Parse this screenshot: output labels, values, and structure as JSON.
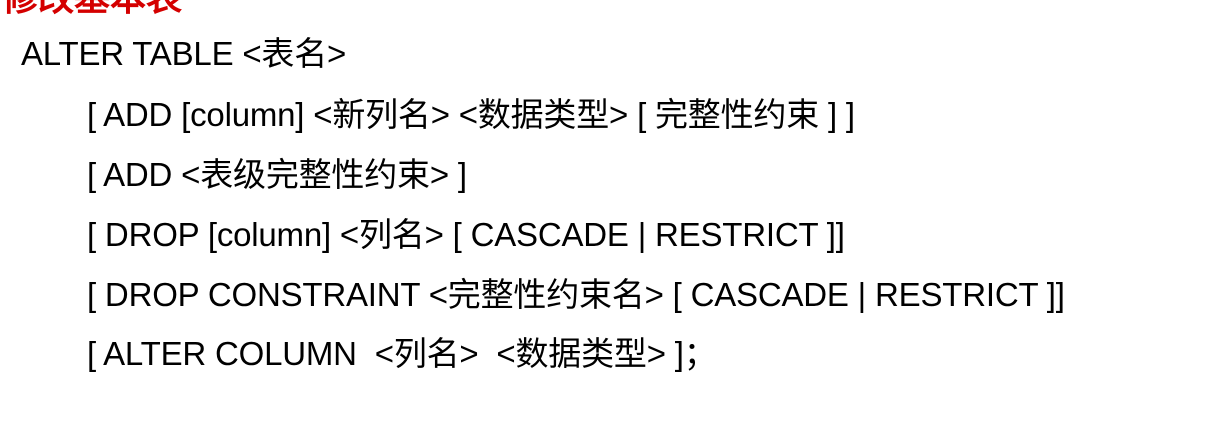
{
  "heading": "修改基本表",
  "syntax_lines": [
    "ALTER TABLE <表名>",
    "[ ADD [column] <新列名> <数据类型> [ 完整性约束 ] ]",
    "[ ADD <表级完整性约束> ]",
    "[ DROP [column] <列名> [ CASCADE | RESTRICT ]]",
    "[ DROP CONSTRAINT <完整性约束名> [ CASCADE | RESTRICT ]]",
    "[ ALTER COLUMN  <列名>  <数据类型> ]；"
  ],
  "colors": {
    "heading": "#d40000",
    "text": "#000000",
    "background": "#ffffff"
  }
}
